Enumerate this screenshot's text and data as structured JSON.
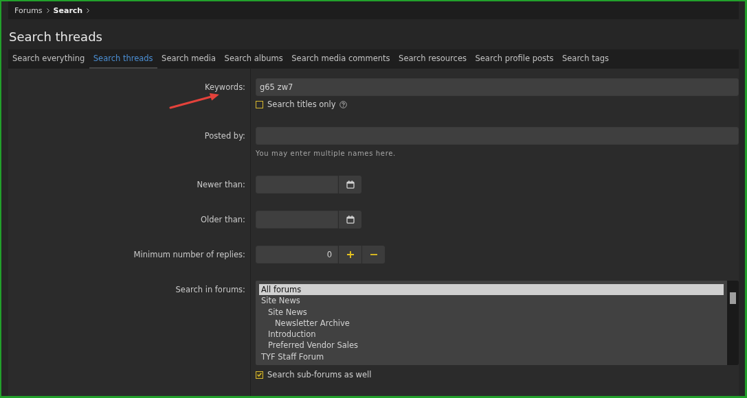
{
  "breadcrumb": [
    {
      "label": "Forums",
      "current": false
    },
    {
      "label": "Search",
      "current": true
    }
  ],
  "title": "Search threads",
  "tabs": [
    {
      "label": "Search everything",
      "selected": false
    },
    {
      "label": "Search threads",
      "selected": true
    },
    {
      "label": "Search media",
      "selected": false
    },
    {
      "label": "Search albums",
      "selected": false
    },
    {
      "label": "Search media comments",
      "selected": false
    },
    {
      "label": "Search resources",
      "selected": false
    },
    {
      "label": "Search profile posts",
      "selected": false
    },
    {
      "label": "Search tags",
      "selected": false
    }
  ],
  "rows": [
    {
      "kind": "text",
      "label": "Keywords:",
      "value": "g65 zw7",
      "option": {
        "label": "Search titles only",
        "checked": false,
        "help": true
      }
    },
    {
      "kind": "text",
      "label": "Posted by:",
      "hint": "You may enter multiple names here."
    },
    {
      "kind": "date",
      "label": "Newer than:"
    },
    {
      "kind": "date",
      "label": "Older than:"
    },
    {
      "kind": "number",
      "label": "Minimum number of replies:",
      "value": "0"
    },
    {
      "kind": "forums",
      "label": "Search in forums:",
      "forums": [
        {
          "label": "All forums",
          "selected": true
        },
        {
          "label": "Site News",
          "selected": false,
          "children": [
            {
              "label": "Site News",
              "selected": false,
              "children": [
                {
                  "label": "Newsletter Archive",
                  "selected": false
                }
              ]
            },
            {
              "label": "Introduction",
              "selected": false
            },
            {
              "label": "Preferred Vendor Sales",
              "selected": false
            }
          ]
        },
        {
          "label": "TYF Staff Forum",
          "selected": false
        }
      ],
      "option": {
        "label": "Search sub-forums as well",
        "checked": true
      }
    }
  ]
}
